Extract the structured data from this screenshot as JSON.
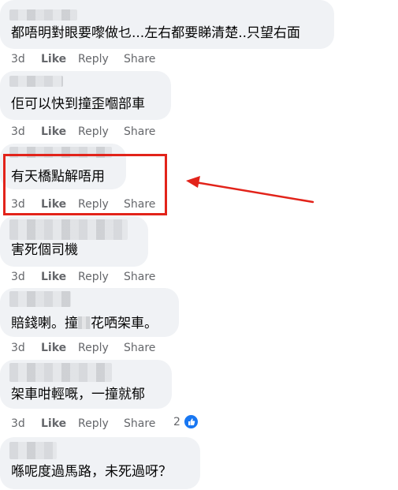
{
  "comments": [
    {
      "text": "都唔明對眼要嚟做乜...左右都要睇清楚..只望右面",
      "actions": {
        "time": "3d",
        "like": "Like",
        "reply": "Reply",
        "share": "Share"
      }
    },
    {
      "text": "佢可以快到撞歪嗰部車",
      "actions": {
        "time": "3d",
        "like": "Like",
        "reply": "Reply",
        "share": "Share"
      }
    },
    {
      "text": "有天橋點解唔用",
      "actions": {
        "time": "3d",
        "like": "Like",
        "reply": "Reply",
        "share": "Share"
      }
    },
    {
      "text": "害死個司機",
      "actions": {
        "time": "3d",
        "like": "Like",
        "reply": "Reply",
        "share": "Share"
      }
    },
    {
      "text_before": "賠錢喇。撞",
      "text_after": "花哂架車。",
      "actions": {
        "time": "3d",
        "like": "Like",
        "reply": "Reply",
        "share": "Share"
      }
    },
    {
      "text": "架車咁輕嘅，一撞就郁",
      "actions": {
        "time": "3d",
        "like": "Like",
        "reply": "Reply",
        "share": "Share"
      },
      "reactions": {
        "count": "2",
        "icon": "thumbs-up-icon",
        "color": "#1877f2"
      }
    },
    {
      "text": "喺呢度過馬路，未死過呀？"
    }
  ],
  "annotation": {
    "color": "#e2231a",
    "shapes": [
      "highlight-box",
      "arrow"
    ]
  }
}
